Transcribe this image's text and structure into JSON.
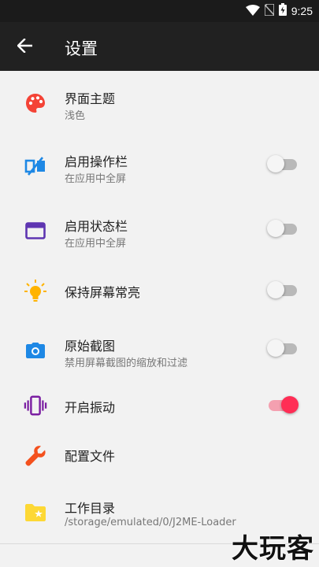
{
  "status_bar": {
    "time": "9:25",
    "icons": [
      "wifi-icon",
      "no-sim-icon",
      "battery-icon"
    ]
  },
  "app_bar": {
    "title": "设置",
    "back_icon": "arrow-back-icon"
  },
  "settings": [
    {
      "id": "theme",
      "title": "界面主题",
      "subtitle": "浅色",
      "icon": "palette-icon",
      "icon_color": "#f44336"
    },
    {
      "id": "action-bar",
      "title": "启用操作栏",
      "subtitle": "在应用中全屏",
      "icon": "action-bar-icon",
      "icon_color": "#1e88e5",
      "toggle": false
    },
    {
      "id": "status-bar",
      "title": "启用状态栏",
      "subtitle": "在应用中全屏",
      "icon": "window-icon",
      "icon_color": "#5e35b1",
      "toggle": false
    },
    {
      "id": "keep-screen-on",
      "title": "保持屏幕常亮",
      "icon": "lightbulb-icon",
      "icon_color": "#ffb300",
      "toggle": false
    },
    {
      "id": "raw-screenshot",
      "title": "原始截图",
      "subtitle": "禁用屏幕截图的缩放和过滤",
      "icon": "camera-icon",
      "icon_color": "#1e88e5",
      "toggle": false
    },
    {
      "id": "vibration",
      "title": "开启振动",
      "icon": "vibration-icon",
      "icon_color": "#7b1fa2",
      "toggle": true
    },
    {
      "id": "config-file",
      "title": "配置文件",
      "icon": "wrench-icon",
      "icon_color": "#f4511e"
    },
    {
      "id": "work-dir",
      "title": "工作目录",
      "subtitle": "/storage/emulated/0/J2ME-Loader",
      "icon": "folder-star-icon",
      "icon_color": "#fdd835"
    }
  ],
  "watermark": "大玩客",
  "colors": {
    "app_bar": "#212121",
    "background": "#f2f2f2",
    "accent": "#ff2d55"
  }
}
